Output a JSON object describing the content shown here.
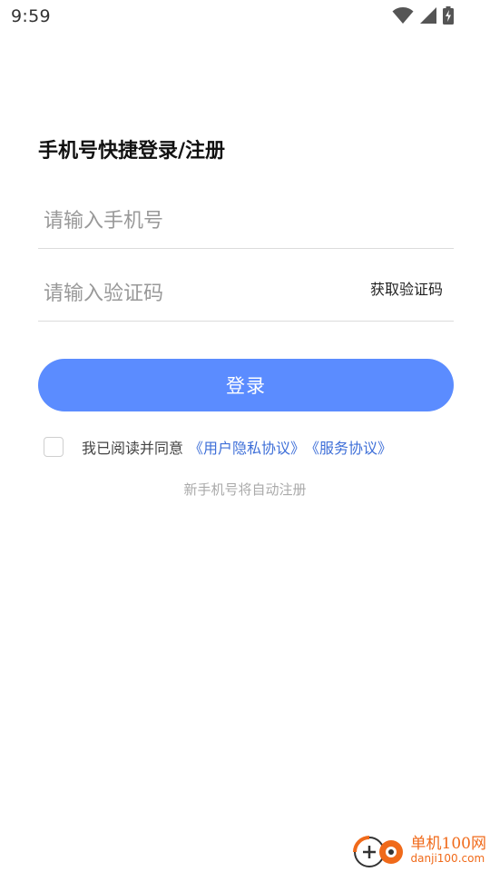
{
  "status_bar": {
    "time": "9:59",
    "icons": [
      "wifi-icon",
      "cell-signal-icon",
      "battery-charging-icon"
    ]
  },
  "page": {
    "title": "手机号快捷登录/注册"
  },
  "phone_input": {
    "value": "",
    "placeholder": "请输入手机号"
  },
  "code_input": {
    "value": "",
    "placeholder": "请输入验证码",
    "get_code_label": "获取验证码"
  },
  "login_button": {
    "label": "登录"
  },
  "agreement": {
    "checked": false,
    "prefix": "我已阅读并同意",
    "privacy_link": "《用户隐私协议》",
    "service_link": "《服务协议》"
  },
  "auto_register_note": "新手机号将自动注册",
  "watermark": {
    "title": "单机100网",
    "domain": "danji100.com"
  },
  "colors": {
    "primary_button": "#5b8cff",
    "link": "#3e6fd8",
    "watermark": "#f06a1a"
  }
}
